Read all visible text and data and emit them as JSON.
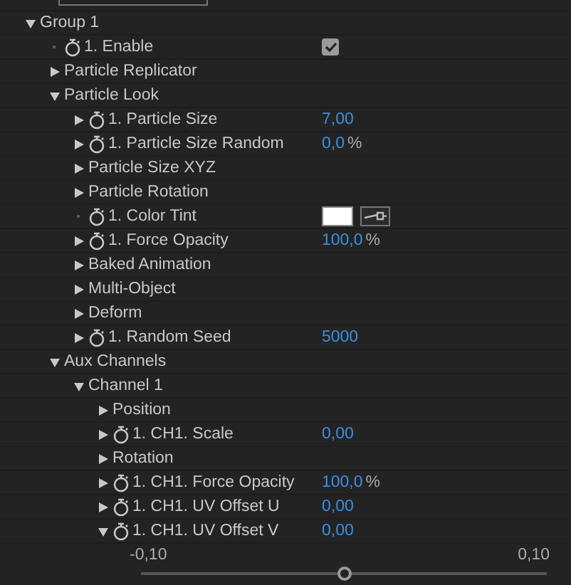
{
  "tree": [
    {
      "label": "Group 1",
      "expanded": true,
      "children": [
        {
          "label": "1. Enable",
          "stopwatch": true,
          "value": {
            "kind": "checkbox",
            "checked": true
          }
        },
        {
          "label": "Particle Replicator",
          "expanded": false
        },
        {
          "label": "Particle Look",
          "expanded": true,
          "children": [
            {
              "label": "1. Particle Size",
              "expanded": false,
              "stopwatch": true,
              "value": {
                "kind": "number",
                "text": "7,00"
              }
            },
            {
              "label": "1. Particle Size Random",
              "expanded": false,
              "stopwatch": true,
              "value": {
                "kind": "percent",
                "text": "0,0",
                "unit": "%"
              }
            },
            {
              "label": "Particle Size XYZ",
              "expanded": false
            },
            {
              "label": "Particle Rotation",
              "expanded": false
            },
            {
              "label": "1. Color Tint",
              "stopwatch": true,
              "value": {
                "kind": "color",
                "color": "#ffffff"
              }
            },
            {
              "label": "1. Force Opacity",
              "expanded": false,
              "stopwatch": true,
              "value": {
                "kind": "percent",
                "text": "100,0",
                "unit": "%"
              }
            },
            {
              "label": "Baked Animation",
              "expanded": false
            },
            {
              "label": "Multi-Object",
              "expanded": false
            },
            {
              "label": "Deform",
              "expanded": false
            },
            {
              "label": "1. Random Seed",
              "expanded": false,
              "stopwatch": true,
              "value": {
                "kind": "number",
                "text": "5000"
              }
            }
          ]
        },
        {
          "label": "Aux Channels",
          "expanded": true,
          "children": [
            {
              "label": "Channel 1",
              "expanded": true,
              "children": [
                {
                  "label": "Position",
                  "expanded": false
                },
                {
                  "label": "1. CH1. Scale",
                  "expanded": false,
                  "stopwatch": true,
                  "value": {
                    "kind": "number",
                    "text": "0,00"
                  }
                },
                {
                  "label": "Rotation",
                  "expanded": false
                },
                {
                  "label": "1. CH1. Force Opacity",
                  "expanded": false,
                  "stopwatch": true,
                  "value": {
                    "kind": "percent",
                    "text": "100,0",
                    "unit": "%"
                  }
                },
                {
                  "label": "1. CH1. UV Offset U",
                  "expanded": false,
                  "stopwatch": true,
                  "value": {
                    "kind": "number",
                    "text": "0,00"
                  }
                },
                {
                  "label": "1. CH1. UV Offset V",
                  "expanded": true,
                  "stopwatch": true,
                  "value": {
                    "kind": "number",
                    "text": "0,00"
                  },
                  "slider": {
                    "min": "-0,10",
                    "max": "0,10",
                    "level": 0.5
                  }
                }
              ]
            }
          ]
        }
      ]
    }
  ]
}
